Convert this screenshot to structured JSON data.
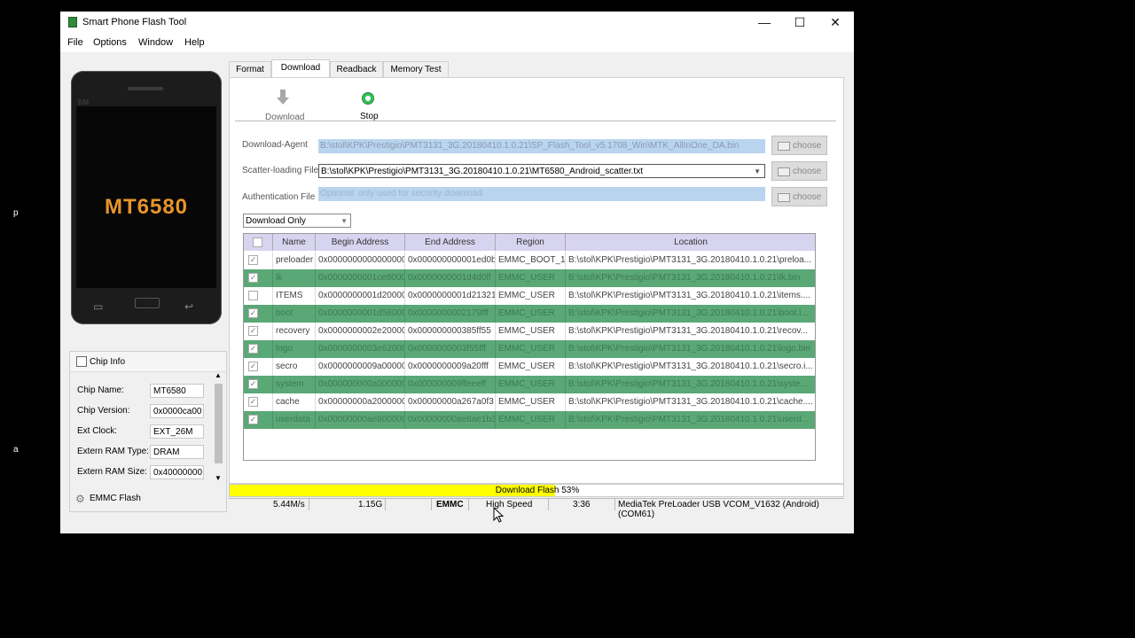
{
  "side_text": {
    "left_p": "p",
    "left_a": "a"
  },
  "window": {
    "title": "Smart Phone Flash Tool",
    "controls": {
      "minimize": "—",
      "maximize": "☐",
      "close": "✕"
    }
  },
  "menu": [
    "File",
    "Options",
    "Window",
    "Help"
  ],
  "phone": {
    "brand": "BM",
    "chip_model": "MT6580"
  },
  "chip_info": {
    "title": "Chip Info",
    "fields": [
      {
        "label": "Chip Name:",
        "value": "MT6580"
      },
      {
        "label": "Chip Version:",
        "value": "0x0000ca00"
      },
      {
        "label": "Ext Clock:",
        "value": "EXT_26M"
      },
      {
        "label": "Extern RAM Type:",
        "value": "DRAM"
      },
      {
        "label": "Extern RAM Size:",
        "value": "0x40000000"
      }
    ],
    "emmc_label": "EMMC Flash"
  },
  "tabs": [
    "Format",
    "Download",
    "Readback",
    "Memory Test"
  ],
  "active_tab": "Download",
  "toolbar": {
    "download_label": "Download",
    "stop_label": "Stop"
  },
  "files": {
    "download_agent": {
      "label": "Download-Agent",
      "value": "B:\\stol\\KPK\\Prestigio\\PMT3131_3G.20180410.1.0.21\\SP_Flash_Tool_v5.1708_Win\\MTK_AllInOne_DA.bin"
    },
    "scatter": {
      "label": "Scatter-loading File",
      "value": "B:\\stol\\KPK\\Prestigio\\PMT3131_3G.20180410.1.0.21\\MT6580_Android_scatter.txt"
    },
    "auth": {
      "label": "Authentication File",
      "placeholder": "Optional: only used for security download"
    },
    "choose_label": "choose"
  },
  "mode": "Download Only",
  "table": {
    "headers": [
      "Name",
      "Begin Address",
      "End Address",
      "Region",
      "Location"
    ],
    "rows": [
      {
        "name": "preloader",
        "begin": "0x0000000000000000",
        "end": "0x000000000001ed0b",
        "region": "EMMC_BOOT_1",
        "location": "B:\\stol\\KPK\\Prestigio\\PMT3131_3G.20180410.1.0.21\\preloa..."
      },
      {
        "name": "lk",
        "begin": "0x0000000001ce8000",
        "end": "0x0000000001d4d0ff",
        "region": "EMMC_USER",
        "location": "B:\\stol\\KPK\\Prestigio\\PMT3131_3G.20180410.1.0.21\\lk.bin"
      },
      {
        "name": "ITEMS",
        "begin": "0x0000000001d20000",
        "end": "0x0000000001d21321",
        "region": "EMMC_USER",
        "location": "B:\\stol\\KPK\\Prestigio\\PMT3131_3G.20180410.1.0.21\\items...."
      },
      {
        "name": "boot",
        "begin": "0x0000000001d58000",
        "end": "0x0000000002179fff",
        "region": "EMMC_USER",
        "location": "B:\\stol\\KPK\\Prestigio\\PMT3131_3G.20180410.1.0.21\\boot.i..."
      },
      {
        "name": "recovery",
        "begin": "0x0000000002e20000",
        "end": "0x000000000385ff55",
        "region": "EMMC_USER",
        "location": "B:\\stol\\KPK\\Prestigio\\PMT3131_3G.20180410.1.0.21\\recov..."
      },
      {
        "name": "logo",
        "begin": "0x0000000003e62000",
        "end": "0x0000000003f55fff",
        "region": "EMMC_USER",
        "location": "B:\\stol\\KPK\\Prestigio\\PMT3131_3G.20180410.1.0.21\\logo.bin"
      },
      {
        "name": "secro",
        "begin": "0x0000000009a00000",
        "end": "0x0000000009a20fff",
        "region": "EMMC_USER",
        "location": "B:\\stol\\KPK\\Prestigio\\PMT3131_3G.20180410.1.0.21\\secro.i..."
      },
      {
        "name": "system",
        "begin": "0x000000000a000000",
        "end": "0x000000009ffeeeff",
        "region": "EMMC_USER",
        "location": "B:\\stol\\KPK\\Prestigio\\PMT3131_3G.20180410.1.0.21\\syste..."
      },
      {
        "name": "cache",
        "begin": "0x00000000a2000000",
        "end": "0x00000000a267a0f3",
        "region": "EMMC_USER",
        "location": "B:\\stol\\KPK\\Prestigio\\PMT3131_3G.20180410.1.0.21\\cache...."
      },
      {
        "name": "userdata",
        "begin": "0x00000000ae800000",
        "end": "0x00000000ae8ae1b3",
        "region": "EMMC_USER",
        "location": "B:\\stol\\KPK\\Prestigio\\PMT3131_3G.20180410.1.0.21\\userd..."
      }
    ]
  },
  "progress": {
    "label": "Download Flash 53%",
    "percent": 53,
    "color": "#ffff00"
  },
  "status": {
    "speed": "5.44M/s",
    "size": "1.15G",
    "storage": "EMMC",
    "usb": "High Speed",
    "time": "3:36",
    "port": "MediaTek PreLoader USB VCOM_V1632 (Android) (COM61)"
  },
  "colors": {
    "row_green": "#5aa876",
    "header_bg": "#d7d4f0",
    "chip_orange": "#e8952b"
  }
}
